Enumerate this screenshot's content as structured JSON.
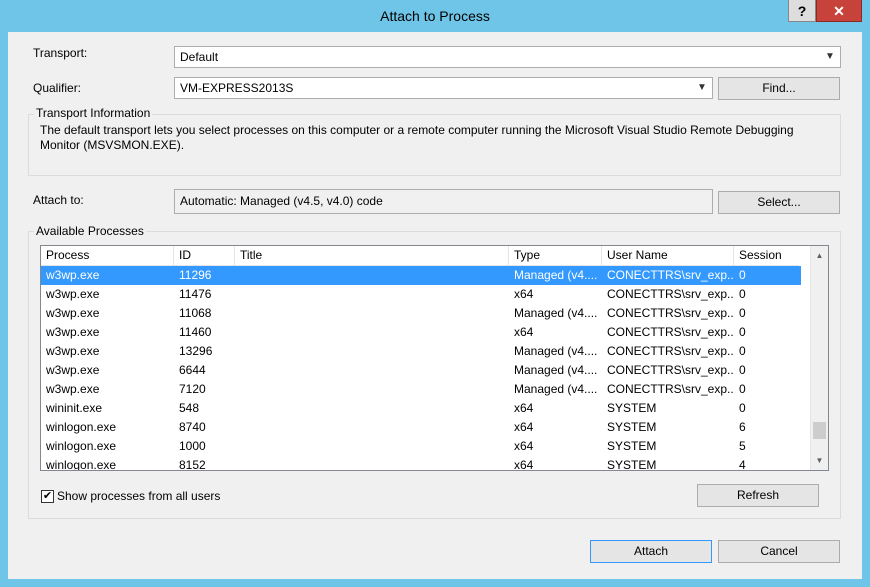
{
  "window": {
    "title": "Attach to Process",
    "help_label": "?",
    "close_label": "✕"
  },
  "transport": {
    "label": "Transport:",
    "value": "Default"
  },
  "qualifier": {
    "label": "Qualifier:",
    "value": "VM-EXPRESS2013S",
    "find_label": "Find..."
  },
  "transport_info": {
    "heading": "Transport Information",
    "line1": "The default transport lets you select processes on this computer or a remote computer running the Microsoft Visual Studio Remote Debugging",
    "line2": "Monitor (MSVSMON.EXE)."
  },
  "attach_to": {
    "label": "Attach to:",
    "value": "Automatic: Managed (v4.5, v4.0) code",
    "select_label": "Select..."
  },
  "processes": {
    "heading": "Available Processes",
    "columns": [
      "Process",
      "ID",
      "Title",
      "Type",
      "User Name",
      "Session"
    ],
    "rows": [
      [
        "w3wp.exe",
        "11296",
        "",
        "Managed (v4....",
        "CONECTTRS\\srv_exp...",
        "0"
      ],
      [
        "w3wp.exe",
        "11476",
        "",
        "x64",
        "CONECTTRS\\srv_exp...",
        "0"
      ],
      [
        "w3wp.exe",
        "11068",
        "",
        "Managed (v4....",
        "CONECTTRS\\srv_exp...",
        "0"
      ],
      [
        "w3wp.exe",
        "11460",
        "",
        "x64",
        "CONECTTRS\\srv_exp...",
        "0"
      ],
      [
        "w3wp.exe",
        "13296",
        "",
        "Managed (v4....",
        "CONECTTRS\\srv_exp...",
        "0"
      ],
      [
        "w3wp.exe",
        "6644",
        "",
        "Managed (v4....",
        "CONECTTRS\\srv_exp...",
        "0"
      ],
      [
        "w3wp.exe",
        "7120",
        "",
        "Managed (v4....",
        "CONECTTRS\\srv_exp...",
        "0"
      ],
      [
        "wininit.exe",
        "548",
        "",
        "x64",
        "SYSTEM",
        "0"
      ],
      [
        "winlogon.exe",
        "8740",
        "",
        "x64",
        "SYSTEM",
        "6"
      ],
      [
        "winlogon.exe",
        "1000",
        "",
        "x64",
        "SYSTEM",
        "5"
      ],
      [
        "winlogon.exe",
        "8152",
        "",
        "x64",
        "SYSTEM",
        "4"
      ]
    ],
    "selected_row": 0,
    "show_all_label": "Show processes from all users",
    "show_all_checked": true,
    "refresh_label": "Refresh"
  },
  "footer": {
    "attach_label": "Attach",
    "cancel_label": "Cancel"
  },
  "colors": {
    "accent": "#3399ff",
    "frame": "#6fc5e8",
    "close": "#c7423a"
  }
}
